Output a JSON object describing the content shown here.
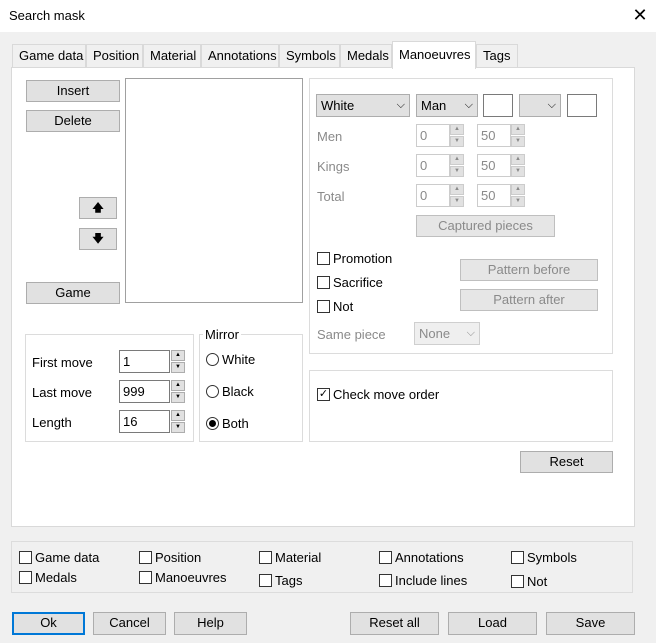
{
  "window": {
    "title": "Search mask",
    "close_glyph": "✕"
  },
  "tabs": [
    "Game data",
    "Position",
    "Material",
    "Annotations",
    "Symbols",
    "Medals",
    "Manoeuvres",
    "Tags"
  ],
  "active_tab": "Manoeuvres",
  "list_buttons": {
    "insert": "Insert",
    "delete": "Delete",
    "up": "🡅",
    "down": "🡇",
    "game": "Game"
  },
  "piece_filter": {
    "color": "White",
    "piece": "Man",
    "relation_value": "",
    "rows": [
      {
        "label": "Men",
        "from": "0",
        "to": "50"
      },
      {
        "label": "Kings",
        "from": "0",
        "to": "50"
      },
      {
        "label": "Total",
        "from": "0",
        "to": "50"
      }
    ],
    "captured_label": "Captured pieces",
    "promotion_label": "Promotion",
    "sacrifice_label": "Sacrifice",
    "not_label": "Not",
    "pattern_before": "Pattern before",
    "pattern_after": "Pattern after",
    "same_piece_label": "Same piece",
    "same_piece_value": "None"
  },
  "moves": {
    "first_label": "First move",
    "first_value": "1",
    "last_label": "Last move",
    "last_value": "999",
    "length_label": "Length",
    "length_value": "16"
  },
  "mirror": {
    "label": "Mirror",
    "options": [
      "White",
      "Black",
      "Both"
    ],
    "selected": "Both"
  },
  "check_move_order": {
    "label": "Check move order",
    "checked": true
  },
  "reset_label": "Reset",
  "bottom_checks": [
    {
      "label": "Game data",
      "checked": false
    },
    {
      "label": "Position",
      "checked": false
    },
    {
      "label": "Material",
      "checked": false
    },
    {
      "label": "Annotations",
      "checked": false
    },
    {
      "label": "Symbols",
      "checked": false
    },
    {
      "label": "Medals",
      "checked": false
    },
    {
      "label": "Manoeuvres",
      "checked": false
    },
    {
      "label": "Tags",
      "checked": false
    },
    {
      "label": "Include lines",
      "checked": false
    },
    {
      "label": "Not",
      "checked": false
    }
  ],
  "footer": {
    "ok": "Ok",
    "cancel": "Cancel",
    "help": "Help",
    "reset_all": "Reset all",
    "load": "Load",
    "save": "Save"
  },
  "colors": {
    "accent": "#0078d7",
    "disabled_text": "#8a8a8a",
    "button_face": "#e1e1e1"
  },
  "icons": {
    "up": "arrow-up-icon",
    "down": "arrow-down-icon",
    "close": "close-icon",
    "dropdown": "chevron-down-icon"
  }
}
